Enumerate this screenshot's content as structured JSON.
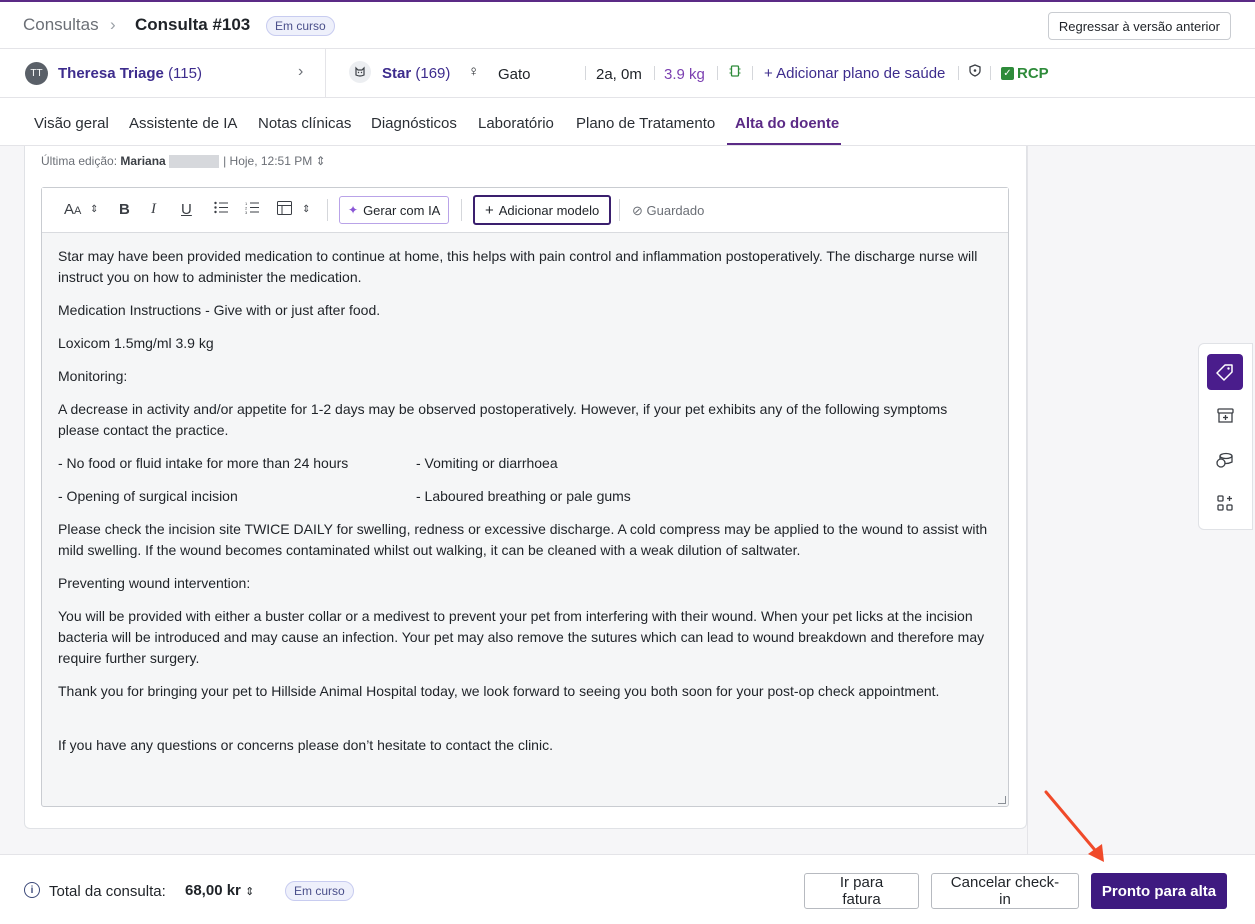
{
  "breadcrumb": {
    "root": "Consultas",
    "separator": "›",
    "current": "Consulta #103",
    "status": "Em curso"
  },
  "header": {
    "revert_button": "Regressar à versão anterior"
  },
  "owner": {
    "initials": "TT",
    "name": "Theresa Triage",
    "count": "(115)"
  },
  "pet": {
    "icon": "cat-icon",
    "name": "Star",
    "count": "(169)",
    "sex_symbol": "♀",
    "species": "Gato",
    "age": "2a, 0m",
    "weight": "3.9 kg",
    "add_plan": "+ Adicionar plano de saúde",
    "rcp": "RCP"
  },
  "tabs": [
    {
      "label": "Visão geral"
    },
    {
      "label": "Assistente de IA"
    },
    {
      "label": "Notas clínicas"
    },
    {
      "label": "Diagnósticos"
    },
    {
      "label": "Laboratório"
    },
    {
      "label": "Plano de Tratamento"
    },
    {
      "label": "Alta do doente",
      "active": true
    }
  ],
  "last_edit": {
    "label": "Última edição:",
    "user": "Mariana",
    "time": "| Hoje, 12:51 PM"
  },
  "toolbar": {
    "ai_button": "Gerar com IA",
    "template_button": "Adicionar modelo",
    "saved": "Guardado"
  },
  "document": {
    "p1": "Star may have been provided medication to continue at home, this helps with pain control and inflammation postoperatively. The discharge nurse will instruct you on how to administer the medication.",
    "p2": "Medication Instructions - Give with or just after food.",
    "p3": "Loxicom 1.5mg/ml 3.9 kg",
    "p4": "Monitoring:",
    "p5": "A decrease in activity and/or appetite for 1-2 days may be observed postoperatively. However, if your pet exhibits any of the following symptoms please contact the practice.",
    "row1_left": "- No food or fluid intake for more than 24 hours",
    "row1_right": "- Vomiting or diarrhoea",
    "row2_left": "- Opening of surgical incision",
    "row2_right": "- Laboured breathing or pale gums",
    "p6": "Please check the incision site TWICE DAILY for swelling, redness or excessive discharge. A cold compress may be applied to the wound to assist with mild swelling. If the wound becomes contaminated whilst out walking, it can be cleaned with a weak dilution of saltwater.",
    "p7": "Preventing wound intervention:",
    "p8": "You will be provided with either a buster collar or a medivest to prevent your pet from interfering with their wound. When your pet licks at the incision bacteria will be introduced and may cause an infection. Your pet may also remove the sutures which can lead to wound breakdown and therefore may require further surgery.",
    "p9": "Thank you for bringing your pet to Hillside Animal Hospital today, we look forward to seeing you both soon for your post-op check appointment.",
    "p10": "If you have any questions or concerns please don’t hesitate to contact the clinic."
  },
  "footer": {
    "total_label": "Total da consulta:",
    "total_value": "68,00 kr",
    "status": "Em curso",
    "invoice_button": "Ir para fatura",
    "cancel_button": "Cancelar check-in",
    "ready_button": "Pronto para alta"
  },
  "colors": {
    "brand": "#3e1a80",
    "accent_purple": "#5b2a86",
    "success": "#2e8b3a",
    "annotation_arrow": "#f04a2a"
  }
}
